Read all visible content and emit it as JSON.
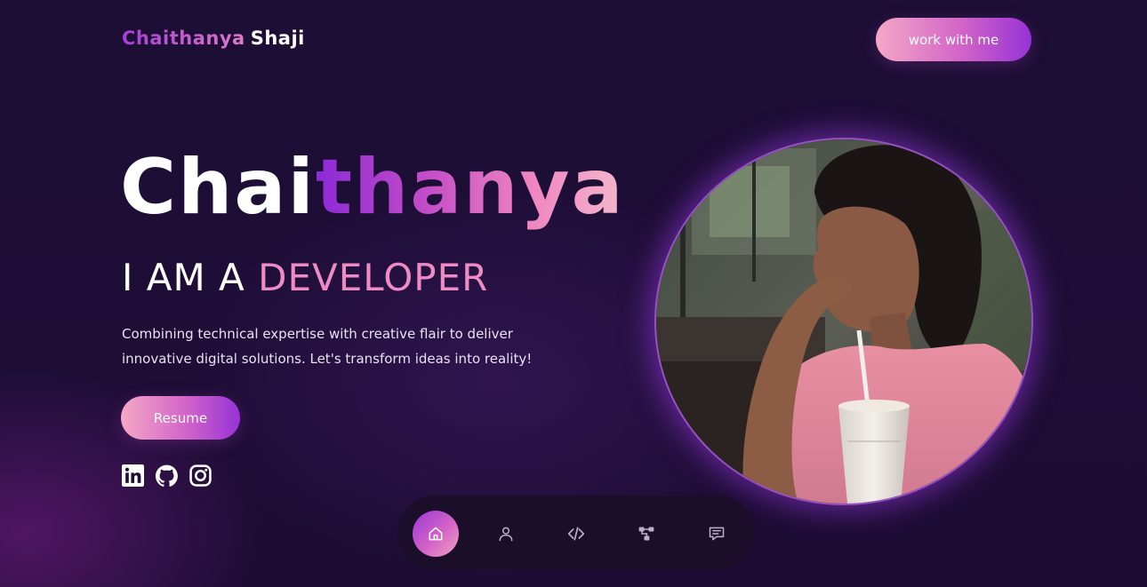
{
  "header": {
    "logo_first": "Chaithanya",
    "logo_last": "Shaji",
    "cta_label": "work with me"
  },
  "hero": {
    "name_plain": "Chai",
    "name_gradient": "thanya",
    "role_prefix": "I AM A",
    "role_highlight": "DEVELOPER",
    "tagline": "Combining technical expertise with creative flair to deliver innovative digital solutions. Let's transform ideas into reality!",
    "resume_label": "Resume"
  },
  "socials": [
    "linkedin-icon",
    "github-icon",
    "instagram-icon"
  ],
  "dock": {
    "items": [
      "home-icon",
      "user-icon",
      "code-icon",
      "project-tree-icon",
      "chat-icon"
    ],
    "active_index": 0
  },
  "colors": {
    "background": "#1d0e35",
    "accent_purple": "#9633d6",
    "accent_pink": "#ee8bc4",
    "dock_bg": "#1a0e2b"
  }
}
